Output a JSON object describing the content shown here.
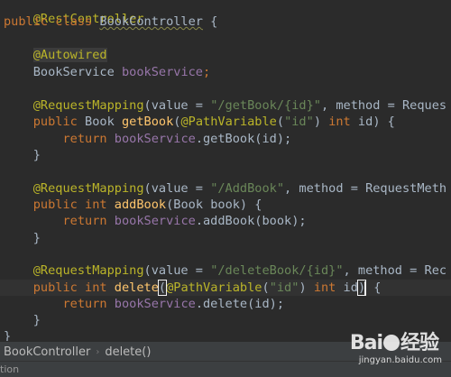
{
  "code_lines": [
    "@RestController",
    "public class BookController {",
    "",
    "    @Autowired",
    "    BookService bookService;",
    "",
    "    @RequestMapping(value = \"/getBook/{id}\", method = RequestMethod",
    "    public Book getBook(@PathVariable(\"id\") int id) {",
    "        return bookService.getBook(id);",
    "    }",
    "",
    "    @RequestMapping(value = \"/AddBook\", method = RequestMethod",
    "    public int addBook(Book book) {",
    "        return bookService.addBook(book);",
    "    }",
    "",
    "    @RequestMapping(value = \"/deleteBook/{id}\", method = RequestMethod",
    "    public int delete(@PathVariable(\"id\") int id) {",
    "        return bookService.delete(id);",
    "    }",
    "}"
  ],
  "tokens": {
    "ann_rest": "@RestController",
    "kw_public": "public",
    "kw_class": "class",
    "cls_name": "BookController",
    "brace_open": " {",
    "ann_autowired": "@Autowired",
    "type_bookservice": "BookService",
    "fld_bookservice": "bookService",
    "semi": ";",
    "ann_reqmap": "@RequestMapping",
    "value_eq": "(value = ",
    "str_get": "\"/getBook/{id}\"",
    "str_add": "\"/AddBook\"",
    "str_del": "\"/deleteBook/{id}\"",
    "method_eq": ", method = ",
    "req_method_trunc1": "Reques",
    "req_method_trunc2": "RequestMeth",
    "req_method_trunc3": "Rec",
    "type_book": "Book",
    "kw_int": "int",
    "fn_getbook": "getBook",
    "fn_addbook": "addBook",
    "fn_delete": "delete",
    "ann_pathvar": "@PathVariable",
    "str_id": "\"id\"",
    "param_id": " id",
    "kw_return": "return",
    "call_getbook": ".getBook(id);",
    "call_addbook": ".addBook(book);",
    "call_delete": ".delete(id);",
    "param_book_book": "(Book book) {",
    "close_brace": "}"
  },
  "breadcrumb": {
    "class_crumb": "BookController",
    "method_crumb": "delete()",
    "separator": "›"
  },
  "status": {
    "text": "tion"
  },
  "watermark": {
    "brand": "Bai",
    "brand_suffix": "经验",
    "url": "jingyan.baidu.com"
  }
}
